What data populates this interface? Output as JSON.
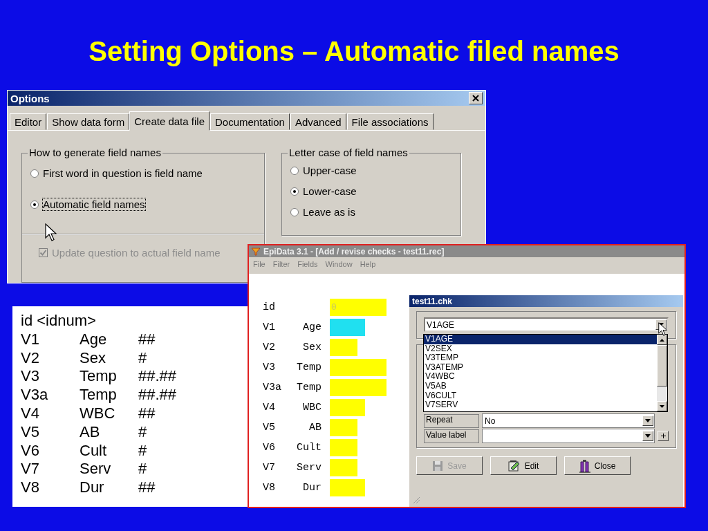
{
  "title": "Setting Options – Automatic filed names",
  "options_window": {
    "title": "Options",
    "tabs": [
      {
        "label": "Editor",
        "selected": false
      },
      {
        "label": "Show data form",
        "selected": false
      },
      {
        "label": "Create data file",
        "selected": true
      },
      {
        "label": "Documentation",
        "selected": false
      },
      {
        "label": "Advanced",
        "selected": false
      },
      {
        "label": "File associations",
        "selected": false
      }
    ],
    "field_names_group": {
      "title": "How to generate field names",
      "options": [
        {
          "label": "First word in question is field name",
          "selected": false
        },
        {
          "label": "Automatic field names",
          "selected": true
        }
      ],
      "update_checkbox": {
        "label": "Update question to actual field name",
        "checked": true,
        "disabled": true
      }
    },
    "letter_case_group": {
      "title": "Letter case of field names",
      "options": [
        {
          "label": "Upper-case",
          "selected": false
        },
        {
          "label": "Lower-case",
          "selected": true
        },
        {
          "label": "Leave as is",
          "selected": false
        }
      ]
    }
  },
  "definitions": [
    {
      "name": "id <idnum>"
    },
    {
      "name": "V1",
      "question": "Age",
      "format": "##"
    },
    {
      "name": "V2",
      "question": "Sex",
      "format": "#"
    },
    {
      "name": "V3",
      "question": "Temp",
      "format": "##.##"
    },
    {
      "name": "V3a",
      "question": "Temp",
      "format": "##.##"
    },
    {
      "name": "V4",
      "question": "WBC",
      "format": "##"
    },
    {
      "name": "V5",
      "question": "AB",
      "format": "#"
    },
    {
      "name": "V6",
      "question": "Cult",
      "format": "#"
    },
    {
      "name": "V7",
      "question": "Serv",
      "format": "#"
    },
    {
      "name": "V8",
      "question": "Dur",
      "format": "##"
    }
  ],
  "epidata_window": {
    "title": "EpiData 3.1 - [Add / revise checks - test11.rec]",
    "menu": [
      "File",
      "Filter",
      "Fields",
      "Window",
      "Help"
    ],
    "fields": [
      {
        "name": "id",
        "value": "0",
        "selected": false
      },
      {
        "name": "V1",
        "question": "Age",
        "selected": true
      },
      {
        "name": "V2",
        "question": "Sex",
        "selected": false
      },
      {
        "name": "V3",
        "question": "Temp",
        "selected": false
      },
      {
        "name": "V3a",
        "question": "Temp",
        "selected": false
      },
      {
        "name": "V4",
        "question": "WBC",
        "selected": false
      },
      {
        "name": "V5",
        "question": "AB",
        "selected": false
      },
      {
        "name": "V6",
        "question": "Cult",
        "selected": false
      },
      {
        "name": "V7",
        "question": "Serv",
        "selected": false
      },
      {
        "name": "V8",
        "question": "Dur",
        "selected": false
      }
    ]
  },
  "checks_dialog": {
    "title": "test11.chk",
    "field_select": {
      "value": "V1AGE"
    },
    "field_list": [
      {
        "label": "V1AGE",
        "selected": true
      },
      {
        "label": "V2SEX",
        "selected": false
      },
      {
        "label": "V3TEMP",
        "selected": false
      },
      {
        "label": "V3ATEMP",
        "selected": false
      },
      {
        "label": "V4WBC",
        "selected": false
      },
      {
        "label": "V5AB",
        "selected": false
      },
      {
        "label": "V6CULT",
        "selected": false
      },
      {
        "label": "V7SERV",
        "selected": false
      }
    ],
    "properties": [
      {
        "label": "Repeat",
        "value": "No",
        "add_button": false
      },
      {
        "label": "Value label",
        "add_button": true
      }
    ],
    "buttons": [
      {
        "kind": "save",
        "label": "Save",
        "disabled": true
      },
      {
        "kind": "edit",
        "label": "Edit",
        "disabled": false
      },
      {
        "kind": "close",
        "label": "Close",
        "disabled": false
      }
    ]
  }
}
